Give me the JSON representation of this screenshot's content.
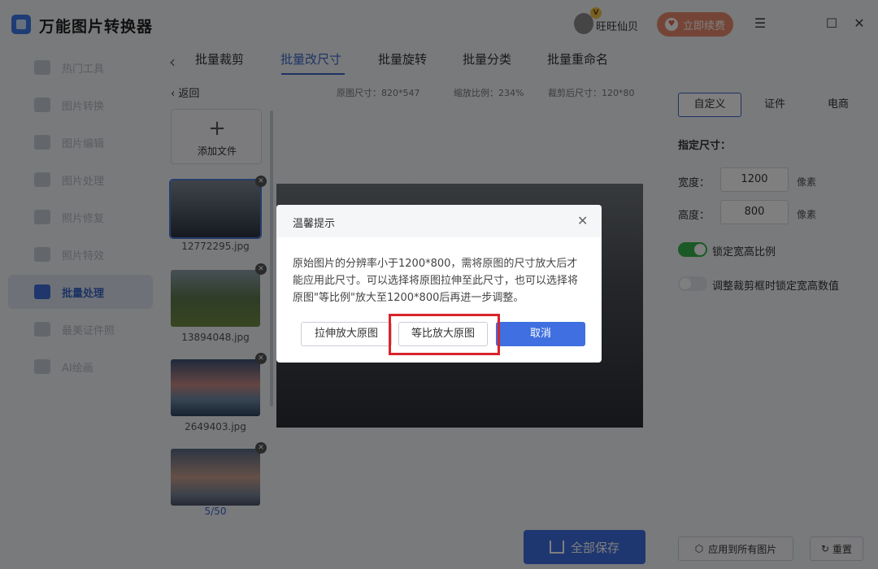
{
  "app": {
    "title": "万能图片转换器",
    "username": "旺旺仙贝",
    "vip_badge": "V",
    "renew_label": "立即续费"
  },
  "window_controls": {
    "menu": "☰",
    "maximize": "☐",
    "close": "✕"
  },
  "sidebar": {
    "items": [
      {
        "label": "热门工具"
      },
      {
        "label": "图片转换"
      },
      {
        "label": "图片编辑"
      },
      {
        "label": "图片处理"
      },
      {
        "label": "照片修复"
      },
      {
        "label": "照片特效"
      },
      {
        "label": "批量处理",
        "active": true
      },
      {
        "label": "最美证件照"
      },
      {
        "label": "AI绘画"
      }
    ]
  },
  "tabs": [
    {
      "label": "批量裁剪"
    },
    {
      "label": "批量改尺寸",
      "active": true
    },
    {
      "label": "批量旋转"
    },
    {
      "label": "批量分类"
    },
    {
      "label": "批量重命名"
    }
  ],
  "inforow": {
    "back": "返回",
    "original_size": "原图尺寸：820*547",
    "zoom": "缩放比例：234%",
    "crop_size": "裁剪后尺寸：120*80"
  },
  "thumbnails": {
    "add_label": "添加文件",
    "files": [
      {
        "name": "12772295.jpg"
      },
      {
        "name": "13894048.jpg"
      },
      {
        "name": "2649403.jpg"
      },
      {
        "name": ""
      }
    ],
    "pager": "5/50"
  },
  "right_panel": {
    "tabs": [
      "自定义",
      "证件",
      "电商"
    ],
    "section_label": "指定尺寸：",
    "width_label": "宽度：",
    "width_value": "1200",
    "height_label": "高度：",
    "height_value": "800",
    "unit": "像素",
    "lock_ratio_label": "锁定宽高比例",
    "lock_crop_label": "调整裁剪框时锁定宽高数值",
    "apply_all_label": "应用到所有图片",
    "reset_label": "重置"
  },
  "save_all_label": "全部保存",
  "dialog": {
    "title": "温馨提示",
    "body": "原始图片的分辨率小于1200*800，需将原图的尺寸放大后才能应用此尺寸。可以选择将原图拉伸至此尺寸，也可以选择将原图\"等比例\"放大至1200*800后再进一步调整。",
    "stretch_label": "拉伸放大原图",
    "proportional_label": "等比放大原图",
    "cancel_label": "取消"
  }
}
